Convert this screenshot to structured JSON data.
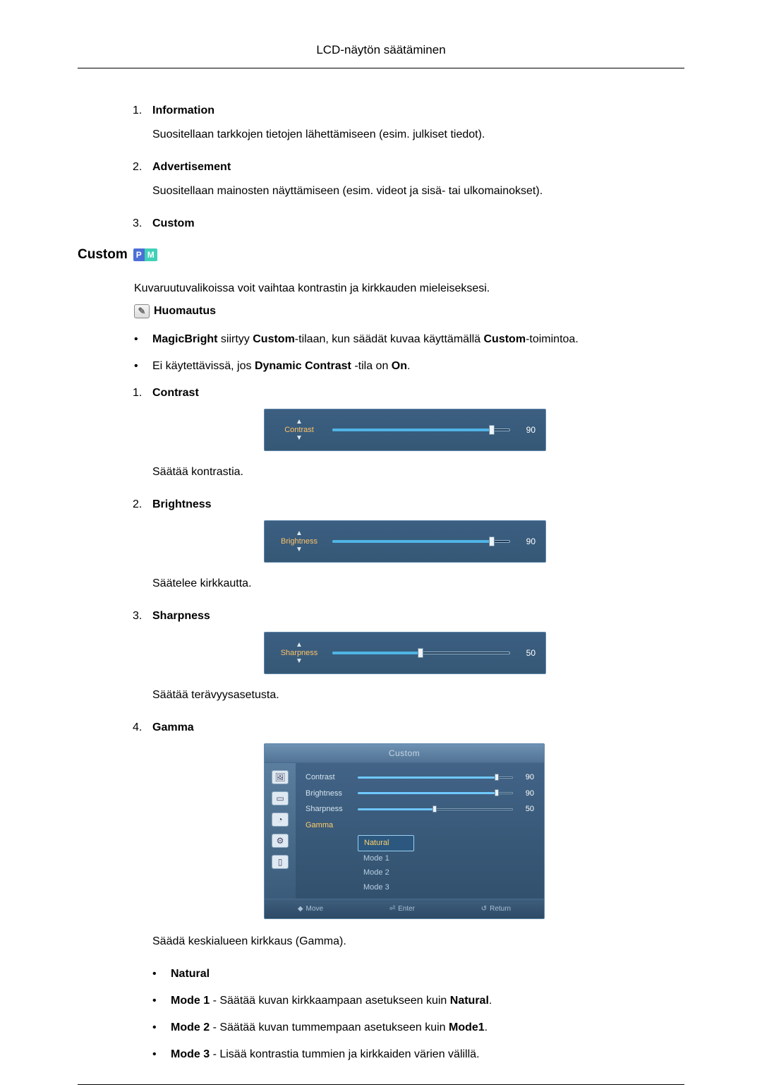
{
  "header": {
    "title": "LCD-näytön säätäminen"
  },
  "top_list": [
    {
      "num": "1.",
      "label": "Information",
      "desc": "Suositellaan tarkkojen tietojen lähettämiseen (esim. julkiset tiedot)."
    },
    {
      "num": "2.",
      "label": "Advertisement",
      "desc": "Suositellaan mainosten näyttämiseen (esim. videot ja sisä- tai ulkomainokset)."
    },
    {
      "num": "3.",
      "label": "Custom",
      "desc": ""
    }
  ],
  "custom": {
    "heading": "Custom",
    "intro": "Kuvaruutuvalikoissa voit vaihtaa kontrastin ja kirkkauden mieleiseksesi.",
    "note_label": "Huomautus",
    "bullets": [
      {
        "pre": "",
        "b1": "MagicBright",
        "mid1": " siirtyy ",
        "b2": "Custom",
        "mid2": "-tilaan, kun säädät kuvaa käyttämällä ",
        "b3": "Custom",
        "post": "-toimintoa."
      },
      {
        "pre": "Ei käytettävissä, jos ",
        "b1": "Dynamic Contrast",
        "mid1": " -tila on ",
        "b2": "On",
        "mid2": ".",
        "b3": "",
        "post": ""
      }
    ],
    "items": [
      {
        "num": "1.",
        "label": "Contrast",
        "osd_label": "Contrast",
        "value": 90,
        "desc": "Säätää kontrastia."
      },
      {
        "num": "2.",
        "label": "Brightness",
        "osd_label": "Brightness",
        "value": 90,
        "desc": "Säätelee kirkkautta."
      },
      {
        "num": "3.",
        "label": "Sharpness",
        "osd_label": "Sharpness",
        "value": 50,
        "desc": "Säätää terävyysasetusta."
      }
    ],
    "gamma": {
      "num": "4.",
      "label": "Gamma",
      "panel_title": "Custom",
      "rows": [
        {
          "label": "Contrast",
          "value": 90
        },
        {
          "label": "Brightness",
          "value": 90
        },
        {
          "label": "Sharpness",
          "value": 50
        }
      ],
      "gamma_label": "Gamma",
      "options": [
        "Natural",
        "Mode 1",
        "Mode 2",
        "Mode 3"
      ],
      "selected": "Natural",
      "footer": {
        "move": "Move",
        "enter": "Enter",
        "return": "Return"
      },
      "desc": "Säädä keskialueen kirkkaus (Gamma).",
      "option_bullets": [
        {
          "b": "Natural",
          "rest": ""
        },
        {
          "b": "Mode 1",
          "rest": " - Säätää kuvan kirkkaampaan asetukseen kuin ",
          "b2": "Natural",
          "post": "."
        },
        {
          "b": "Mode 2",
          "rest": " - Säätää kuvan tummempaan asetukseen kuin ",
          "b2": "Mode1",
          "post": "."
        },
        {
          "b": "Mode 3",
          "rest": " - Lisää kontrastia tummien ja kirkkaiden värien välillä.",
          "b2": "",
          "post": ""
        }
      ]
    }
  }
}
